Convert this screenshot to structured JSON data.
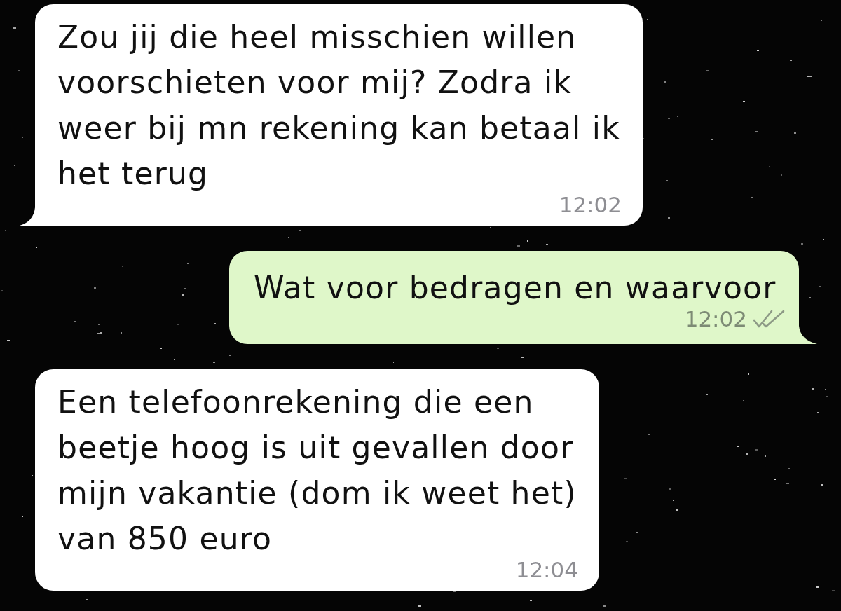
{
  "messages": [
    {
      "kind": "incoming",
      "text": "Zou jij die heel misschien willen voorschieten voor mij? Zodra ik weer bij mn rekening kan betaal ik het terug",
      "time": "12:02",
      "tail": true
    },
    {
      "kind": "outgoing",
      "text": "Wat voor bedragen en waarvoor",
      "time": "12:02",
      "tail": true,
      "read": false
    },
    {
      "kind": "incoming",
      "text": "Een telefoonrekening die een beetje hoog is uit gevallen door mijn vakantie (dom ik weet het) van 850 euro",
      "time": "12:04",
      "tail": false
    }
  ]
}
